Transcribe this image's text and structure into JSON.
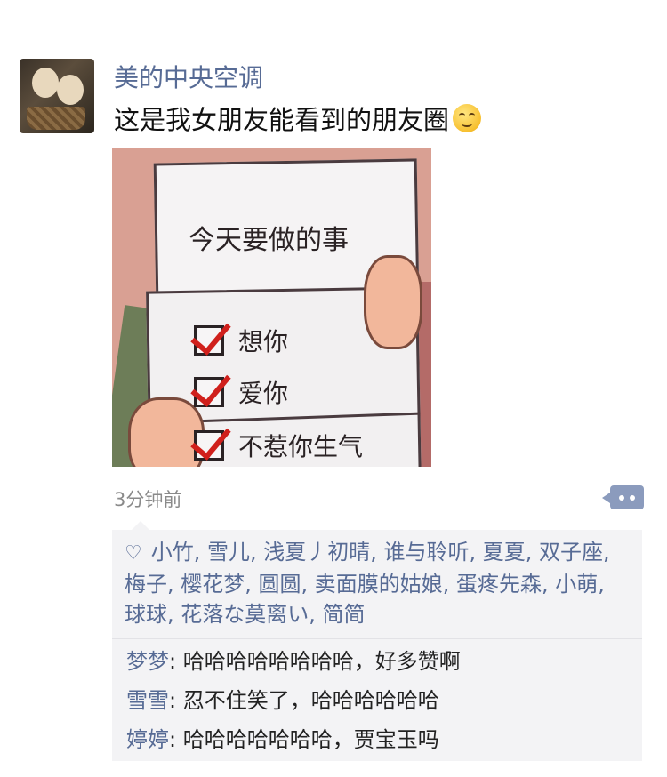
{
  "post": {
    "author": "美的中央空调",
    "text": "这是我女朋友能看到的朋友圈",
    "emoji_icon": "smiling-blush-emoji",
    "time": "3分钟前"
  },
  "image": {
    "title": "今天要做的事",
    "items": [
      "想你",
      "爱你",
      "不惹你生气"
    ]
  },
  "likes": {
    "icon": "heart-outline-icon",
    "names": "小竹, 雪儿, 浅夏丿初晴, 谁与聆听, 夏夏, 双子座, 梅子, 樱花梦, 圆圆, 卖面膜的姑娘, 蛋疼先森, 小萌, 球球, 花落な莫离い, 简简"
  },
  "comments": [
    {
      "name": "梦梦",
      "sep": ": ",
      "text": "哈哈哈哈哈哈哈哈，好多赞啊"
    },
    {
      "name": "雪雪",
      "sep": ": ",
      "text": "忍不住笑了，哈哈哈哈哈哈"
    },
    {
      "name": "婷婷",
      "sep": ": ",
      "text": "哈哈哈哈哈哈哈，贾宝玉吗"
    }
  ],
  "colors": {
    "name_link": "#576b95",
    "comment_bg": "#f3f3f5",
    "check_red": "#d0201c"
  }
}
